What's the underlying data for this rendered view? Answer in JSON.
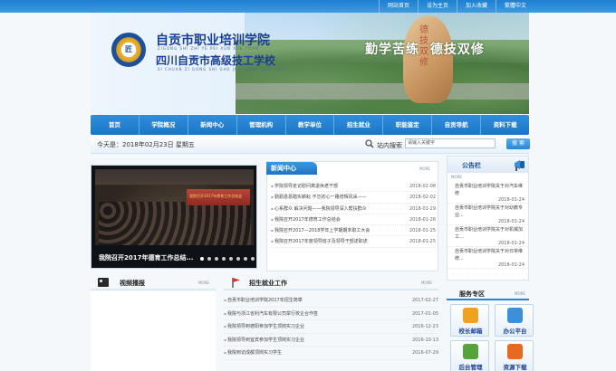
{
  "top_links": [
    "网站首页",
    "设为主页",
    "加入收藏",
    "繁體中文"
  ],
  "header": {
    "school_name_1": "自贡市职业培训学院",
    "school_pinyin_1": "ZIGONG SHI ZHI YE PEI XUN XUE YUAN",
    "school_name_2": "四川自贡市高级技工学校",
    "school_pinyin_2": "SI CHUAN ZI GONG SHI GAO JI JI GONG XUE XIAO",
    "slogan": "勤学苦练  德技双修",
    "rock_text": "德技双修"
  },
  "nav": [
    "首页",
    "学院概况",
    "新闻中心",
    "管理机构",
    "教学单位",
    "招生就业",
    "职能鉴定",
    "自贡导航",
    "资料下载"
  ],
  "date_text": "今天是：2018年02月23日 星期五",
  "search": {
    "label": "站内搜索",
    "placeholder": "请输入关键字",
    "button": "搜 索"
  },
  "slideshow": {
    "caption": "我院召开2017年德育工作总结...",
    "stage_text": "我院召开2017年德育工作总结会",
    "dots": 8,
    "active": 0
  },
  "news": {
    "tab": "新闻中心",
    "more": "MORE",
    "items": [
      {
        "title": "学院领导走访慰问离退休老干部",
        "date": "2018-02-08"
      },
      {
        "title": "勤勤恳恳踏实耕耘 不忘初心一路增辉风采——",
        "date": "2018-02-02"
      },
      {
        "title": "心系群众 解决问题——我院领导深入帮扶群众",
        "date": "2018-01-29"
      },
      {
        "title": "我院召开2017年德育工作总结会",
        "date": "2018-01-26"
      },
      {
        "title": "我院召开2017—2018学年上学期期末职工大会",
        "date": "2018-01-25"
      },
      {
        "title": "我院召开2017年度领导班子及领导干部述职述",
        "date": "2018-01-25"
      }
    ]
  },
  "video": {
    "label": "视频播报",
    "more": "MORE"
  },
  "employment": {
    "label": "招生就业工作",
    "more": "MORE",
    "items": [
      {
        "title": "自贡市职业培训学院2017年招生简章",
        "date": "2017-02-27"
      },
      {
        "title": "我院与浙江省利汽车有限公司举行校企合作签",
        "date": "2017-01-05"
      },
      {
        "title": "我院领导到德阳参加学生顶岗实习企业",
        "date": "2016-12-23"
      },
      {
        "title": "我院领导到宜宾参加学生顶岗实习企业",
        "date": "2016-10-13"
      },
      {
        "title": "我院到访成都顶岗实习学生",
        "date": "2016-07-29"
      }
    ]
  },
  "notice": {
    "label": "公告栏",
    "more": "MORE",
    "items": [
      {
        "title": "自贡市职业培训学院关于对汽车维修",
        "date": "2018-01-24"
      },
      {
        "title": "自贡市职业培训学院关于对幼教专业...",
        "date": "2018-01-24"
      },
      {
        "title": "自贡市职业培训学院关于对机械加工...",
        "date": "2018-01-24"
      },
      {
        "title": "自贡市职业培训学院关于对日常维修...",
        "date": "2018-01-24"
      }
    ]
  },
  "service": {
    "label": "服务专区",
    "more": "MORE",
    "items": [
      "校长邮箱",
      "办公平台",
      "后台管理",
      "资源下载"
    ],
    "colors": [
      "#f0a11e",
      "#3c8fd8",
      "#56a33b",
      "#e66a1f"
    ]
  }
}
